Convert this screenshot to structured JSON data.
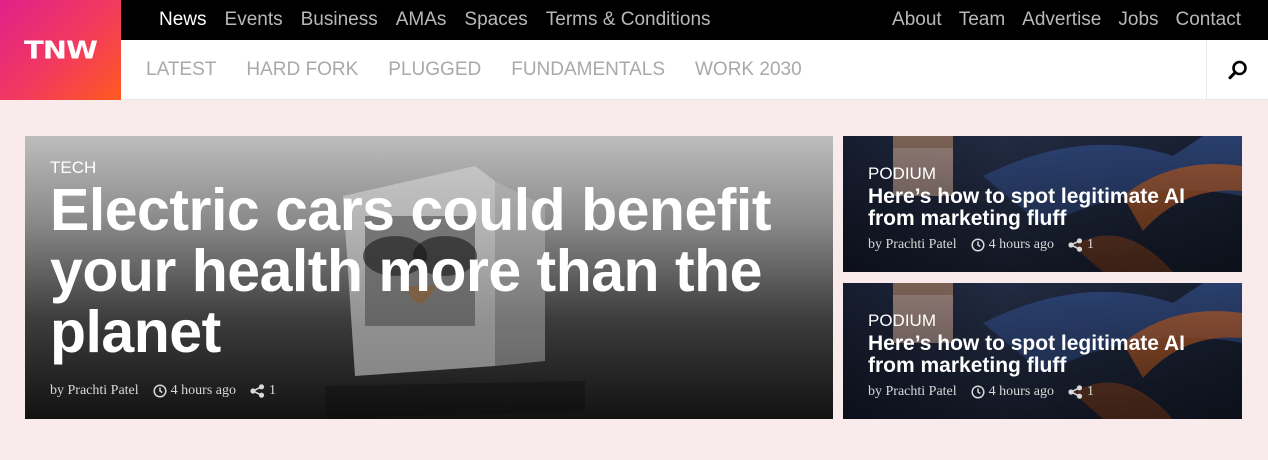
{
  "logo": {
    "text": "TNW"
  },
  "topnav": {
    "left": [
      "News",
      "Events",
      "Business",
      "AMAs",
      "Spaces",
      "Terms & Conditions"
    ],
    "right": [
      "About",
      "Team",
      "Advertise",
      "Jobs",
      "Contact"
    ],
    "active": "News"
  },
  "subnav": {
    "items": [
      "LATEST",
      "HARD FORK",
      "PLUGGED",
      "FUNDAMENTALS",
      "WORK 2030"
    ]
  },
  "hero": {
    "category": "TECH",
    "title": "Electric cars could benefit your health more than the planet",
    "author": "by Prachti Patel",
    "time": "4 hours ago",
    "shares": "1"
  },
  "cards": [
    {
      "category": "PODIUM",
      "title": "Here’s how to spot legitimate AI from marketing fluff",
      "author": "by Prachti Patel",
      "time": "4 hours ago",
      "shares": "1"
    },
    {
      "category": "PODIUM",
      "title": "Here’s how to spot legitimate AI from marketing fluff",
      "author": "by Prachti Patel",
      "time": "4 hours ago",
      "shares": "1"
    }
  ],
  "colors": {
    "brand_start": "#e0218a",
    "brand_end": "#ff5a1f",
    "page_bg": "#f9ebeb",
    "topbar_bg": "#000000"
  },
  "icons": [
    "clock-icon",
    "share-icon",
    "search-icon"
  ]
}
